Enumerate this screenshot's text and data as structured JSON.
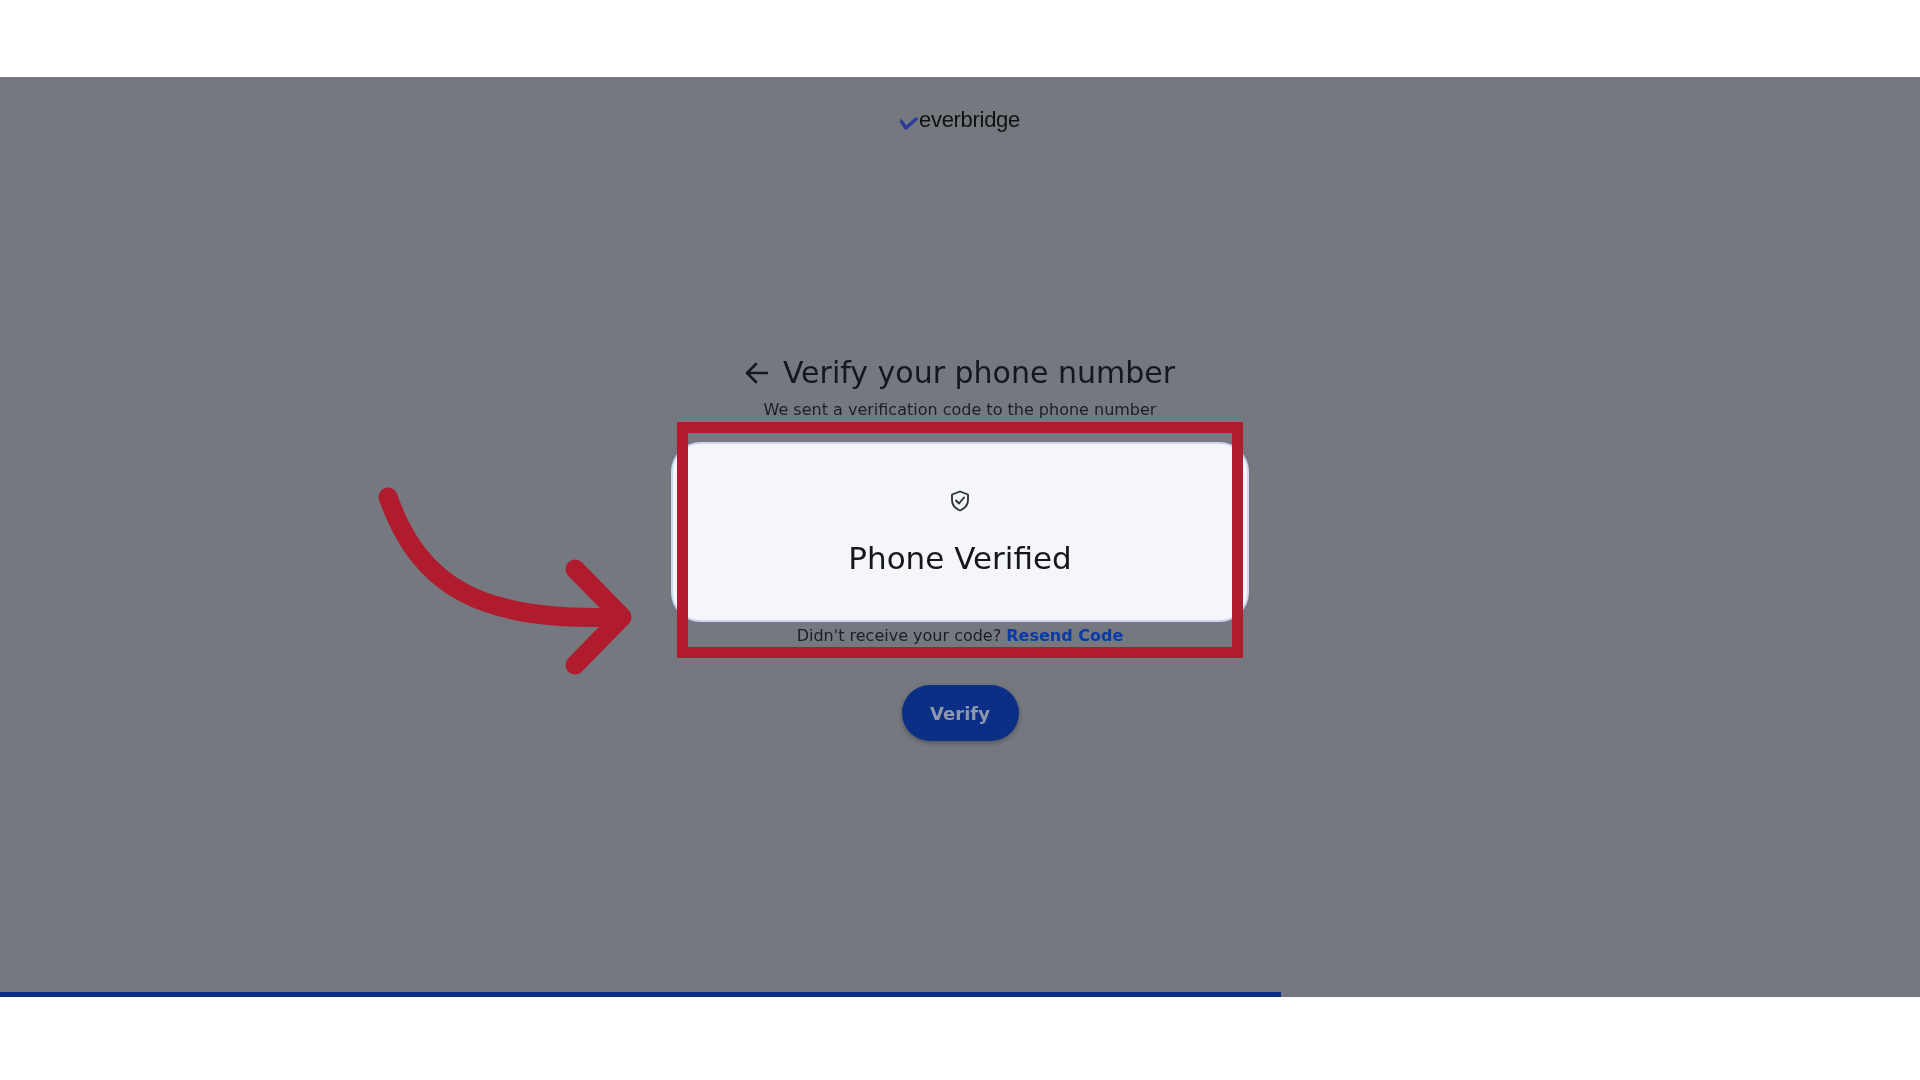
{
  "logo": {
    "text": "everbridge"
  },
  "page": {
    "title": "Verify your phone number",
    "subtitle": "We sent a verification code to the phone number",
    "resend_prompt": "Didn't receive your code?",
    "resend_link": "Resend Code",
    "verify_button": "Verify"
  },
  "dialog": {
    "title": "Phone Verified"
  },
  "progress": {
    "level": 0.667
  }
}
